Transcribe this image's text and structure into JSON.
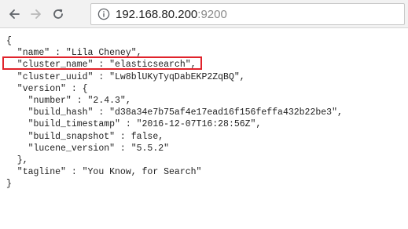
{
  "browser": {
    "back_icon": "back-arrow-icon",
    "forward_icon": "forward-arrow-icon",
    "reload_icon": "reload-icon",
    "info_icon": "info-icon",
    "url_host": "192.168.80.200",
    "url_port": ":9200"
  },
  "json_lines": [
    "{",
    "  \"name\" : \"Lila Cheney\",",
    "  \"cluster_name\" : \"elasticsearch\",",
    "  \"cluster_uuid\" : \"Lw8blUKyTyqDabEKP2ZqBQ\",",
    "  \"version\" : {",
    "    \"number\" : \"2.4.3\",",
    "    \"build_hash\" : \"d38a34e7b75af4e17ead16f156feffa432b22be3\",",
    "    \"build_timestamp\" : \"2016-12-07T16:28:56Z\",",
    "    \"build_snapshot\" : false,",
    "    \"lucene_version\" : \"5.5.2\"",
    "  },",
    "  \"tagline\" : \"You Know, for Search\"",
    "}"
  ],
  "colors": {
    "highlight_border": "#e0232b",
    "toolbar_background": "#f2f2f2"
  }
}
